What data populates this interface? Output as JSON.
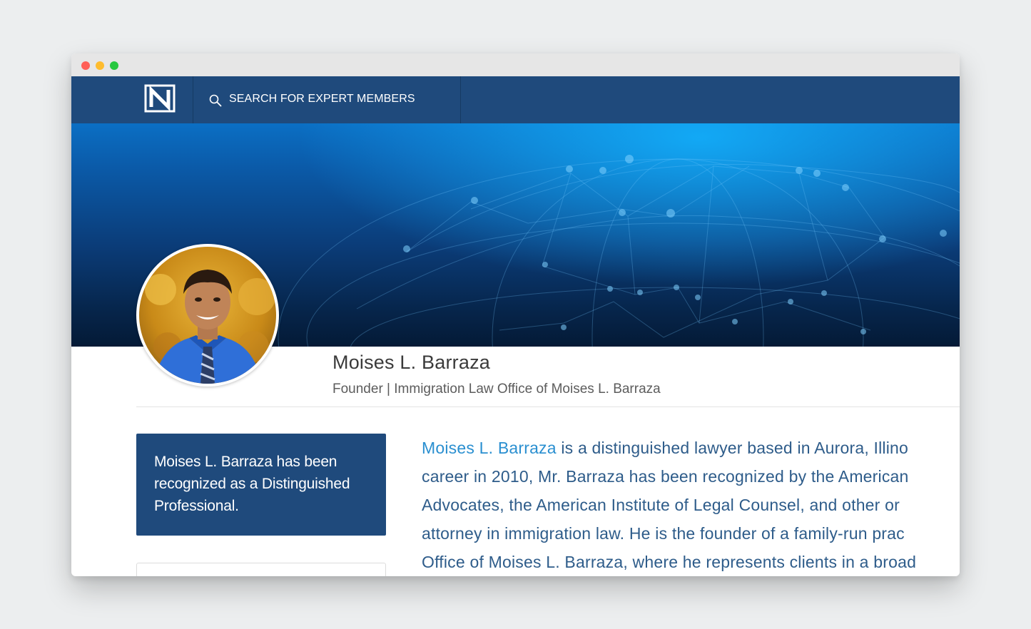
{
  "window": {
    "controls": {
      "close_color": "#ff5f57",
      "minimize_color": "#febc2e",
      "maximize_color": "#28c840"
    }
  },
  "navbar": {
    "logo_icon": "n-logo-icon",
    "search_icon": "search-icon",
    "search_label": "SEARCH FOR EXPERT MEMBERS",
    "background": "#1f4a7c"
  },
  "profile": {
    "name": "Moises L. Barraza",
    "subtitle": "Founder | Immigration Law Office of Moises L. Barraza",
    "avatar_icon": "profile-photo"
  },
  "recognition": {
    "text": "Moises L. Barraza has been recognized as a Distinguished Professional."
  },
  "bio": {
    "link_name": "Moises L. Barraza",
    "line1_rest": " is a distinguished lawyer based in Aurora, Illino",
    "line2": "career in 2010, Mr. Barraza has been recognized by the American",
    "line3": "Advocates, the American Institute of Legal Counsel, and other or",
    "line4": "attorney in immigration law. He is the founder of a family-run prac",
    "line5": "Office of Moises L. Barraza, where he represents clients in a broad"
  },
  "colors": {
    "brand_blue": "#1f4a7c",
    "link_blue": "#2a8fd0",
    "text_blue": "#2e5c8a"
  }
}
